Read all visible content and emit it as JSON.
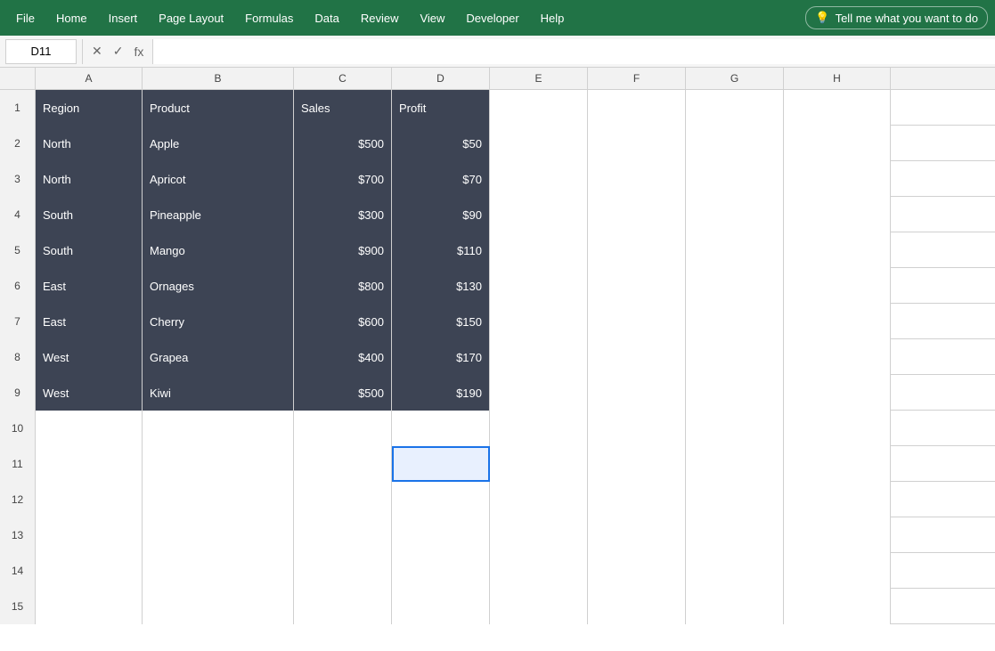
{
  "menubar": {
    "items": [
      "File",
      "Home",
      "Insert",
      "Page Layout",
      "Formulas",
      "Data",
      "Review",
      "View",
      "Developer",
      "Help"
    ],
    "tell_me_label": "Tell me what you want to do",
    "tell_me_icon": "💡"
  },
  "formula_bar": {
    "name_box_value": "D11",
    "cancel_icon": "✕",
    "confirm_icon": "✓",
    "fx_icon": "fx",
    "formula_value": ""
  },
  "columns": {
    "headers": [
      "A",
      "B",
      "C",
      "D",
      "E",
      "F",
      "G",
      "H"
    ]
  },
  "rows": [
    {
      "row_num": "1",
      "data": true,
      "cells": [
        {
          "value": "Region",
          "align": "center",
          "dark": true
        },
        {
          "value": "Product",
          "align": "center",
          "dark": true
        },
        {
          "value": "Sales",
          "align": "center",
          "dark": true
        },
        {
          "value": "Profit",
          "align": "center",
          "dark": true
        },
        {
          "value": "",
          "dark": false
        },
        {
          "value": "",
          "dark": false
        },
        {
          "value": "",
          "dark": false
        },
        {
          "value": "",
          "dark": false
        }
      ]
    },
    {
      "row_num": "2",
      "data": true,
      "cells": [
        {
          "value": "North",
          "align": "left",
          "dark": true
        },
        {
          "value": "Apple",
          "align": "left",
          "dark": true
        },
        {
          "value": "$500",
          "align": "right",
          "dark": true
        },
        {
          "value": "$50",
          "align": "right",
          "dark": true
        },
        {
          "value": "",
          "dark": false
        },
        {
          "value": "",
          "dark": false
        },
        {
          "value": "",
          "dark": false
        },
        {
          "value": "",
          "dark": false
        }
      ]
    },
    {
      "row_num": "3",
      "data": true,
      "cells": [
        {
          "value": "North",
          "align": "left",
          "dark": true
        },
        {
          "value": "Apricot",
          "align": "left",
          "dark": true
        },
        {
          "value": "$700",
          "align": "right",
          "dark": true
        },
        {
          "value": "$70",
          "align": "right",
          "dark": true
        },
        {
          "value": "",
          "dark": false
        },
        {
          "value": "",
          "dark": false
        },
        {
          "value": "",
          "dark": false
        },
        {
          "value": "",
          "dark": false
        }
      ]
    },
    {
      "row_num": "4",
      "data": true,
      "cells": [
        {
          "value": "South",
          "align": "left",
          "dark": true
        },
        {
          "value": "Pineapple",
          "align": "left",
          "dark": true
        },
        {
          "value": "$300",
          "align": "right",
          "dark": true
        },
        {
          "value": "$90",
          "align": "right",
          "dark": true
        },
        {
          "value": "",
          "dark": false
        },
        {
          "value": "",
          "dark": false
        },
        {
          "value": "",
          "dark": false
        },
        {
          "value": "",
          "dark": false
        }
      ]
    },
    {
      "row_num": "5",
      "data": true,
      "cells": [
        {
          "value": "South",
          "align": "left",
          "dark": true
        },
        {
          "value": "Mango",
          "align": "left",
          "dark": true
        },
        {
          "value": "$900",
          "align": "right",
          "dark": true
        },
        {
          "value": "$110",
          "align": "right",
          "dark": true
        },
        {
          "value": "",
          "dark": false
        },
        {
          "value": "",
          "dark": false
        },
        {
          "value": "",
          "dark": false
        },
        {
          "value": "",
          "dark": false
        }
      ]
    },
    {
      "row_num": "6",
      "data": true,
      "cells": [
        {
          "value": "East",
          "align": "left",
          "dark": true
        },
        {
          "value": "Ornages",
          "align": "left",
          "dark": true
        },
        {
          "value": "$800",
          "align": "right",
          "dark": true
        },
        {
          "value": "$130",
          "align": "right",
          "dark": true
        },
        {
          "value": "",
          "dark": false
        },
        {
          "value": "",
          "dark": false
        },
        {
          "value": "",
          "dark": false
        },
        {
          "value": "",
          "dark": false
        }
      ]
    },
    {
      "row_num": "7",
      "data": true,
      "cells": [
        {
          "value": "East",
          "align": "left",
          "dark": true
        },
        {
          "value": "Cherry",
          "align": "left",
          "dark": true
        },
        {
          "value": "$600",
          "align": "right",
          "dark": true
        },
        {
          "value": "$150",
          "align": "right",
          "dark": true
        },
        {
          "value": "",
          "dark": false
        },
        {
          "value": "",
          "dark": false
        },
        {
          "value": "",
          "dark": false
        },
        {
          "value": "",
          "dark": false
        }
      ]
    },
    {
      "row_num": "8",
      "data": true,
      "cells": [
        {
          "value": "West",
          "align": "left",
          "dark": true
        },
        {
          "value": "Grapea",
          "align": "left",
          "dark": true
        },
        {
          "value": "$400",
          "align": "right",
          "dark": true
        },
        {
          "value": "$170",
          "align": "right",
          "dark": true
        },
        {
          "value": "",
          "dark": false
        },
        {
          "value": "",
          "dark": false
        },
        {
          "value": "",
          "dark": false
        },
        {
          "value": "",
          "dark": false
        }
      ]
    },
    {
      "row_num": "9",
      "data": true,
      "cells": [
        {
          "value": "West",
          "align": "left",
          "dark": true
        },
        {
          "value": "Kiwi",
          "align": "left",
          "dark": true
        },
        {
          "value": "$500",
          "align": "right",
          "dark": true
        },
        {
          "value": "$190",
          "align": "right",
          "dark": true
        },
        {
          "value": "",
          "dark": false
        },
        {
          "value": "",
          "dark": false
        },
        {
          "value": "",
          "dark": false
        },
        {
          "value": "",
          "dark": false
        }
      ]
    },
    {
      "row_num": "10",
      "data": false,
      "cells": [
        {
          "value": "",
          "dark": false
        },
        {
          "value": "",
          "dark": false
        },
        {
          "value": "",
          "dark": false
        },
        {
          "value": "",
          "dark": false
        },
        {
          "value": "",
          "dark": false
        },
        {
          "value": "",
          "dark": false
        },
        {
          "value": "",
          "dark": false
        },
        {
          "value": "",
          "dark": false
        }
      ]
    },
    {
      "row_num": "11",
      "data": false,
      "cells": [
        {
          "value": "",
          "dark": false
        },
        {
          "value": "",
          "dark": false
        },
        {
          "value": "",
          "dark": false
        },
        {
          "value": "",
          "dark": false,
          "selected": true
        },
        {
          "value": "",
          "dark": false
        },
        {
          "value": "",
          "dark": false
        },
        {
          "value": "",
          "dark": false
        },
        {
          "value": "",
          "dark": false
        }
      ]
    },
    {
      "row_num": "12",
      "data": false,
      "cells": [
        {
          "value": "",
          "dark": false
        },
        {
          "value": "",
          "dark": false
        },
        {
          "value": "",
          "dark": false
        },
        {
          "value": "",
          "dark": false
        },
        {
          "value": "",
          "dark": false
        },
        {
          "value": "",
          "dark": false
        },
        {
          "value": "",
          "dark": false
        },
        {
          "value": "",
          "dark": false
        }
      ]
    },
    {
      "row_num": "13",
      "data": false,
      "cells": [
        {
          "value": "",
          "dark": false
        },
        {
          "value": "",
          "dark": false
        },
        {
          "value": "",
          "dark": false
        },
        {
          "value": "",
          "dark": false
        },
        {
          "value": "",
          "dark": false
        },
        {
          "value": "",
          "dark": false
        },
        {
          "value": "",
          "dark": false
        },
        {
          "value": "",
          "dark": false
        }
      ]
    },
    {
      "row_num": "14",
      "data": false,
      "cells": [
        {
          "value": "",
          "dark": false
        },
        {
          "value": "",
          "dark": false
        },
        {
          "value": "",
          "dark": false
        },
        {
          "value": "",
          "dark": false
        },
        {
          "value": "",
          "dark": false
        },
        {
          "value": "",
          "dark": false
        },
        {
          "value": "",
          "dark": false
        },
        {
          "value": "",
          "dark": false
        }
      ]
    },
    {
      "row_num": "15",
      "data": false,
      "cells": [
        {
          "value": "",
          "dark": false
        },
        {
          "value": "",
          "dark": false
        },
        {
          "value": "",
          "dark": false
        },
        {
          "value": "",
          "dark": false
        },
        {
          "value": "",
          "dark": false
        },
        {
          "value": "",
          "dark": false
        },
        {
          "value": "",
          "dark": false
        },
        {
          "value": "",
          "dark": false
        }
      ]
    }
  ],
  "col_widths": [
    "120px",
    "170px",
    "110px",
    "110px",
    "110px",
    "110px",
    "110px",
    "120px"
  ]
}
